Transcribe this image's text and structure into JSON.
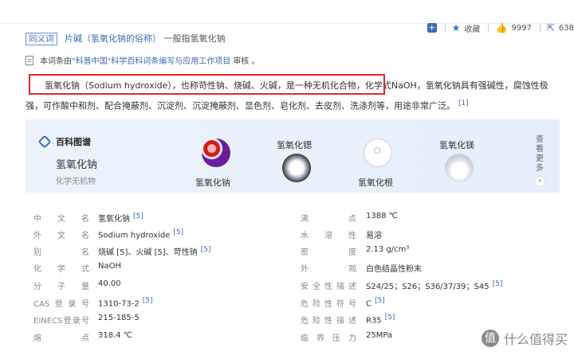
{
  "synonym": {
    "tag": "同义词",
    "link": "片碱（氢氧化钠的俗称）",
    "rest": "一般指氢氧化钠"
  },
  "actions": {
    "collect_label": "收藏",
    "likes": "9997",
    "shares": "638"
  },
  "review": {
    "prefix": "本词条由",
    "link": "\"科普中国\"科学百科词条编写与应用工作项目",
    "suffix": "审核 。"
  },
  "summary": {
    "text": "氢氧化钠（Sodium hydroxide），也称苛性钠、烧碱、火碱，是一种无机化合物，化学式NaOH，氢氧化钠具有强碱性，腐蚀性极强，可作酸中和剂、配合掩蔽剂、沉淀剂、沉淀掩蔽剂、显色剂、皂化剂、去皮剂、洗涤剂等，用途非常广泛。",
    "ref": "[1]"
  },
  "card": {
    "title": "百科图谱",
    "name": "氢氧化钠",
    "subtitle": "化学无机物",
    "items": [
      "氢氧化钠",
      "氢氧化锶",
      "氢氧化根",
      "氢氧化镁"
    ],
    "more": "查看更多"
  },
  "props": {
    "rows": [
      {
        "l_label": "中文名",
        "l_value": "氢氧化钠",
        "l_ref": "[5]",
        "r_label": "沸点",
        "r_value": "1388 ℃",
        "r_ref": ""
      },
      {
        "l_label": "外文名",
        "l_value": "Sodium hydroxide",
        "l_ref": "[5]",
        "r_label": "水溶性",
        "r_value": "易溶",
        "r_ref": ""
      },
      {
        "l_label": "别名",
        "l_value": "烧碱 [5]、火碱 [5]、苛性钠",
        "l_ref": "[5]",
        "r_label": "密度",
        "r_value": "2.13 g/cm³",
        "r_ref": ""
      },
      {
        "l_label": "化学式",
        "l_value": "NaOH",
        "l_ref": "",
        "r_label": "外观",
        "r_value": "白色结晶性粉末",
        "r_ref": ""
      },
      {
        "l_label": "分子量",
        "l_value": "40.00",
        "l_ref": "",
        "r_label": "安全性描述",
        "r_value": "S24/25；S26；S36/37/39；S45",
        "r_ref": "[5]"
      },
      {
        "l_label": "CAS登录号",
        "l_value": "1310-73-2",
        "l_ref": "[5]",
        "r_label": "危险性符号",
        "r_value": "C",
        "r_ref": "[5]"
      },
      {
        "l_label": "EINECS登录号",
        "l_value": "215-185-5",
        "l_ref": "",
        "r_label": "危险性描述",
        "r_value": "R35",
        "r_ref": "[5]"
      },
      {
        "l_label": "熔点",
        "l_value": "318.4 ℃",
        "l_ref": "",
        "r_label": "临界压力",
        "r_value": "25MPa",
        "r_ref": ""
      }
    ]
  },
  "watermark": {
    "icon": "值",
    "text": "什么值得买"
  }
}
